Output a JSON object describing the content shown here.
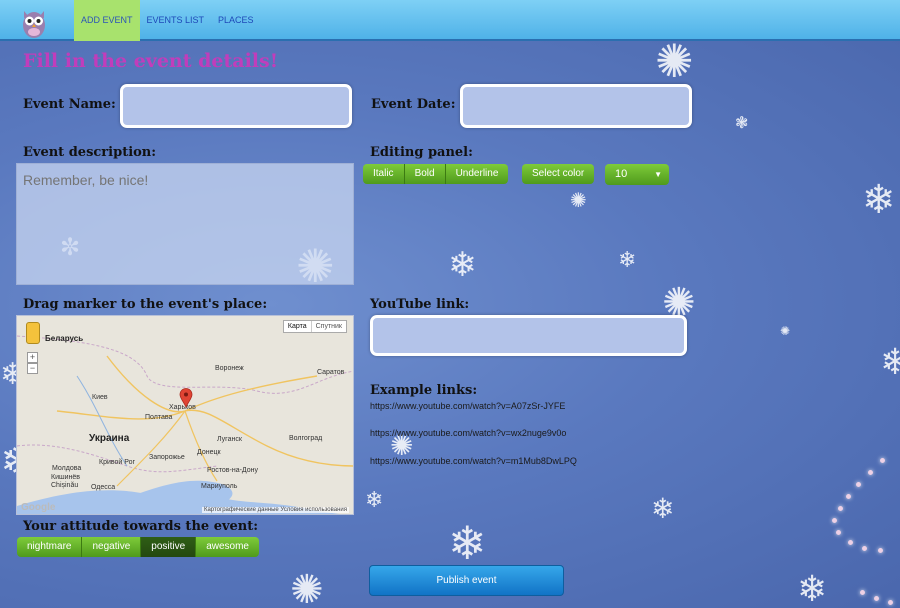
{
  "nav": {
    "logo": "owl-logo",
    "items": [
      "ADD EVENT",
      "EVENTS LIST",
      "PLACES"
    ],
    "active": "ADD EVENT"
  },
  "form": {
    "heading": "Fill in the event details!",
    "event_name_label": "Event Name:",
    "event_name_value": "",
    "event_date_label": "Event Date:",
    "event_date_value": "",
    "description_label": "Event description:",
    "description_placeholder": "Remember, be nice!",
    "editing_label": "Editing panel:",
    "format_buttons": [
      "Italic",
      "Bold",
      "Underline"
    ],
    "select_color": "Select color",
    "font_size": "10",
    "map_label": "Drag marker to the event's place:",
    "youtube_label": "YouTube link:",
    "youtube_value": "",
    "example_label": "Example links:",
    "example_links": [
      "https://www.youtube.com/watch?v=A07zSr-JYFE",
      "https://www.youtube.com/watch?v=wx2nuge9v0o",
      "https://www.youtube.com/watch?v=m1Mub8DwLPQ"
    ],
    "attitude_label": "Your attitude towards the event:",
    "attitude_options": [
      "nightmare",
      "negative",
      "positive",
      "awesome"
    ],
    "attitude_selected": "positive",
    "publish": "Publish event"
  },
  "map": {
    "type_map": "Карта",
    "type_satellite": "Спутник",
    "zoom_in": "+",
    "zoom_out": "−",
    "cities": {
      "belarus": "Беларусь",
      "voronezh": "Воронеж",
      "saratov": "Саратов",
      "kiev": "Киев",
      "poltava": "Полтава",
      "kharkov": "Харьков",
      "ukraina": "Украина",
      "lugansk": "Луганск",
      "volgograd": "Волгоград",
      "zaporozhye": "Запорожье",
      "donetsk": "Донецк",
      "krivoy_rog": "Кривой Рог",
      "moldova": "Молдова",
      "kishinev": "Кишинёв",
      "chisinau": "Chișinău",
      "odessa": "Одесса",
      "mariupol": "Мариуполь",
      "rostov": "Ростов-на-Дону"
    },
    "footer": "Картографические данные   Условия использования",
    "google": "Google"
  },
  "colors": {
    "heading": "#c13dbb",
    "button_green": "#5aa520",
    "button_selected": "#24480f",
    "publish_blue": "#1f8ad8",
    "nav_active": "#a8e26d"
  }
}
